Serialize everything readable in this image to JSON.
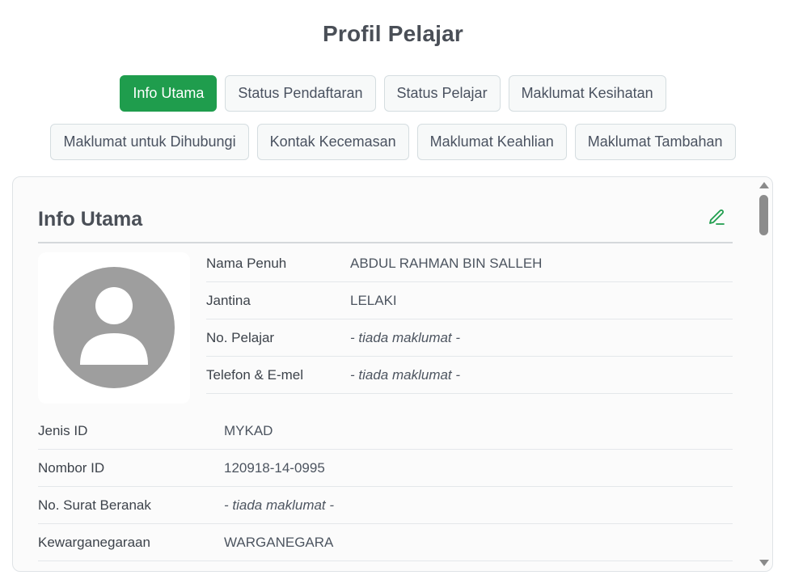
{
  "page": {
    "title": "Profil Pelajar"
  },
  "tabs": [
    {
      "label": "Info Utama",
      "active": true
    },
    {
      "label": "Status Pendaftaran",
      "active": false
    },
    {
      "label": "Status Pelajar",
      "active": false
    },
    {
      "label": "Maklumat Kesihatan",
      "active": false
    },
    {
      "label": "Maklumat untuk Dihubungi",
      "active": false
    },
    {
      "label": "Kontak Kecemasan",
      "active": false
    },
    {
      "label": "Maklumat Keahlian",
      "active": false
    },
    {
      "label": "Maklumat Tambahan",
      "active": false
    }
  ],
  "card": {
    "title": "Info Utama",
    "edit_icon": "pencil-icon",
    "avatar_icon": "user-avatar-icon",
    "side_fields": [
      {
        "label": "Nama Penuh",
        "value": "ABDUL RAHMAN BIN SALLEH"
      },
      {
        "label": "Jantina",
        "value": "LELAKI"
      },
      {
        "label": "No. Pelajar",
        "value": "- tiada maklumat -"
      },
      {
        "label": "Telefon & E-mel",
        "value": "- tiada maklumat -"
      }
    ],
    "fields": [
      {
        "label": "Jenis ID",
        "value": "MYKAD"
      },
      {
        "label": "Nombor ID",
        "value": "120918-14-0995"
      },
      {
        "label": "No. Surat Beranak",
        "value": "- tiada maklumat -"
      },
      {
        "label": "Kewarganegaraan",
        "value": "WARGANEGARA"
      }
    ]
  },
  "colors": {
    "accent": "#1f9d4d",
    "avatar": "#9e9e9e"
  }
}
